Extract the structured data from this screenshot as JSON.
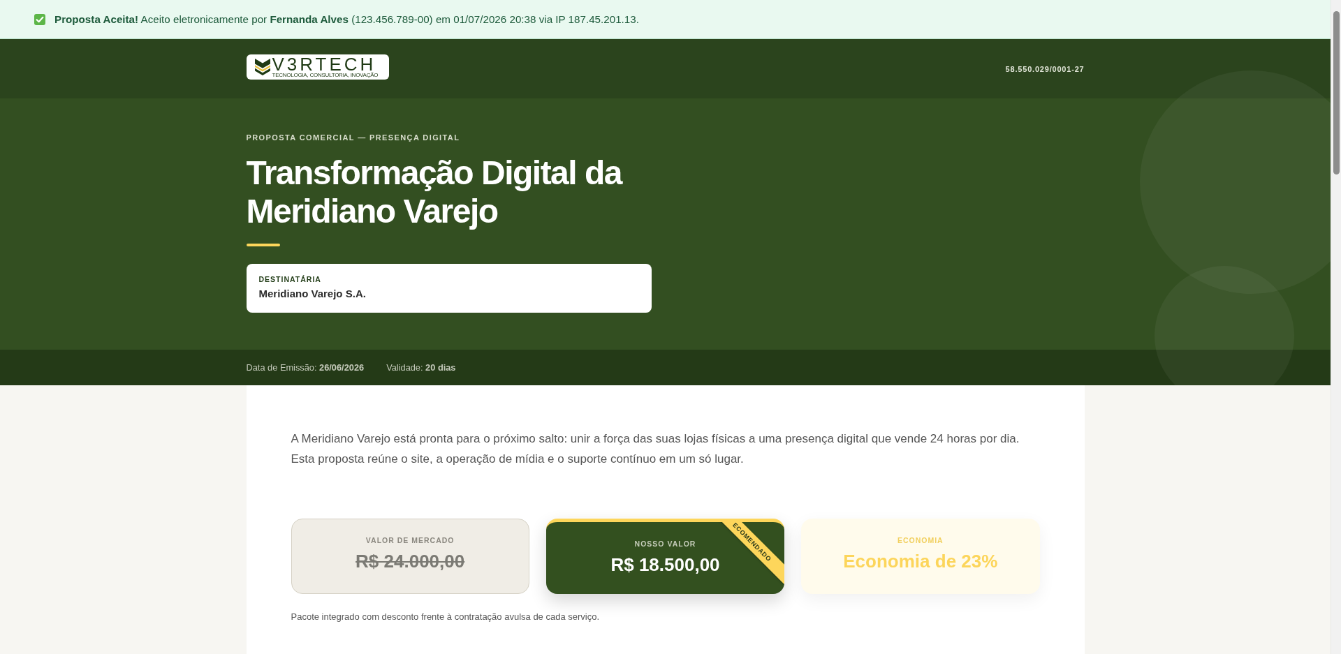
{
  "acceptance_banner": {
    "text": "**Proposta Aceita!** Aceito eletronicamente por **Fernanda Alves** (123.456.789-00) em 01/07/2026 20:38 via IP 187.45.201.13."
  },
  "header": {
    "logo": {
      "name": "V3RTECH",
      "tagline": "TECNOLOGIA, CONSULTORIA, INOVAÇÃO"
    },
    "cnpj": "58.550.029/0001-27"
  },
  "hero": {
    "eyebrow": "PROPOSTA COMERCIAL — PRESENÇA DIGITAL",
    "title": "Transformação Digital da Meridiano Varejo",
    "recipient": {
      "label": "DESTINATÁRIA",
      "value": "Meridiano Varejo S.A."
    }
  },
  "meta": [
    "Data de Emissão: **26/06/2026**",
    "Validade: **20 dias**"
  ],
  "intro": "A Meridiano Varejo está pronta para o próximo salto: unir a força das suas lojas físicas a uma presença digital que vende 24 horas por dia. Esta proposta reúne o site, a operação de mídia e o suporte contínuo em um só lugar.",
  "pricing": {
    "cards": [
      {
        "kind": "market",
        "label": "VALOR DE MERCADO",
        "value": "R$ 24.000,00"
      },
      {
        "kind": "ours",
        "label": "NOSSO VALOR",
        "value": "R$ 18.500,00",
        "ribbon": "ECOMENDADO"
      },
      {
        "kind": "savings",
        "label": "ECONOMIA",
        "value": "Economia de 23%"
      }
    ],
    "note": "Pacote integrado com desconto frente à contratação avulsa de cada serviço."
  }
}
